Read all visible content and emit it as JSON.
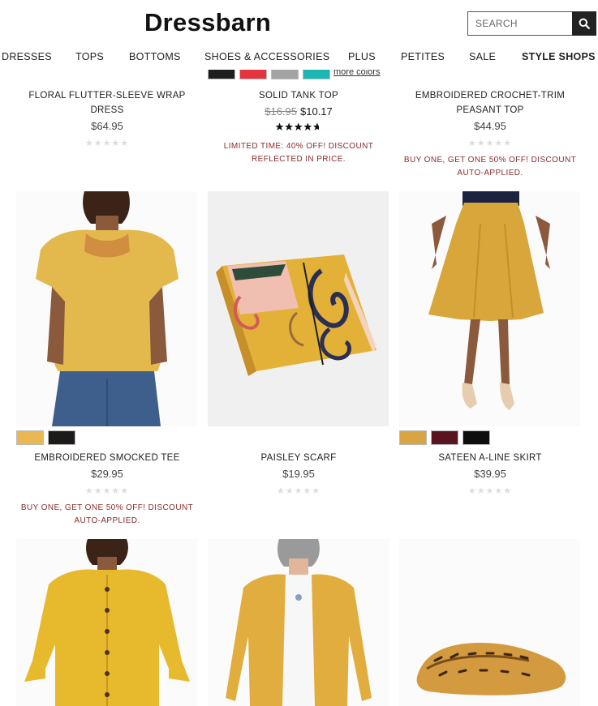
{
  "header": {
    "logo": "Dressbarn",
    "search_placeholder": "SEARCH"
  },
  "nav": [
    "DRESSES",
    "TOPS",
    "BOTTOMS",
    "SHOES & ACCESSORIES",
    "PLUS",
    "PETITES",
    "SALE",
    "STYLE SHOPS"
  ],
  "row1": [
    {
      "name": "FLORAL FLUTTER-SLEEVE WRAP DRESS",
      "price": "$64.95",
      "stars": "★★★★★",
      "promo": ""
    },
    {
      "name": "SOLID TANK TOP",
      "old_price": "$16.95",
      "price": "$10.17",
      "stars": "★★★★★",
      "rating": 4.5,
      "promo": "LIMITED TIME: 40% OFF! DISCOUNT REFLECTED IN PRICE.",
      "more_colors": "more colors",
      "swatches": [
        "#1e1e1e",
        "#e63340",
        "#9a9a9a",
        "#1bb8b3"
      ]
    },
    {
      "name": "EMBROIDERED CROCHET-TRIM PEASANT TOP",
      "price": "$44.95",
      "stars": "★★★★★",
      "promo": "BUY ONE, GET ONE 50% OFF! DISCOUNT AUTO-APPLIED."
    }
  ],
  "row2": [
    {
      "name": "EMBROIDERED SMOCKED TEE",
      "price": "$29.95",
      "stars": "★★★★★",
      "promo": "BUY ONE, GET ONE 50% OFF! DISCOUNT AUTO-APPLIED.",
      "swatches": [
        "#e9b852",
        "#1d1a1a"
      ]
    },
    {
      "name": "PAISLEY SCARF",
      "price": "$19.95",
      "stars": "★★★★★",
      "promo": ""
    },
    {
      "name": "SATEEN A-LINE SKIRT",
      "price": "$39.95",
      "stars": "★★★★★",
      "promo": "",
      "swatches": [
        "#d9a444",
        "#5a1420",
        "#0e0e0e"
      ]
    }
  ],
  "colors": {
    "promo": "#8a2b2b",
    "mustard": "#e0b23d",
    "star_empty": "#dddddd"
  }
}
